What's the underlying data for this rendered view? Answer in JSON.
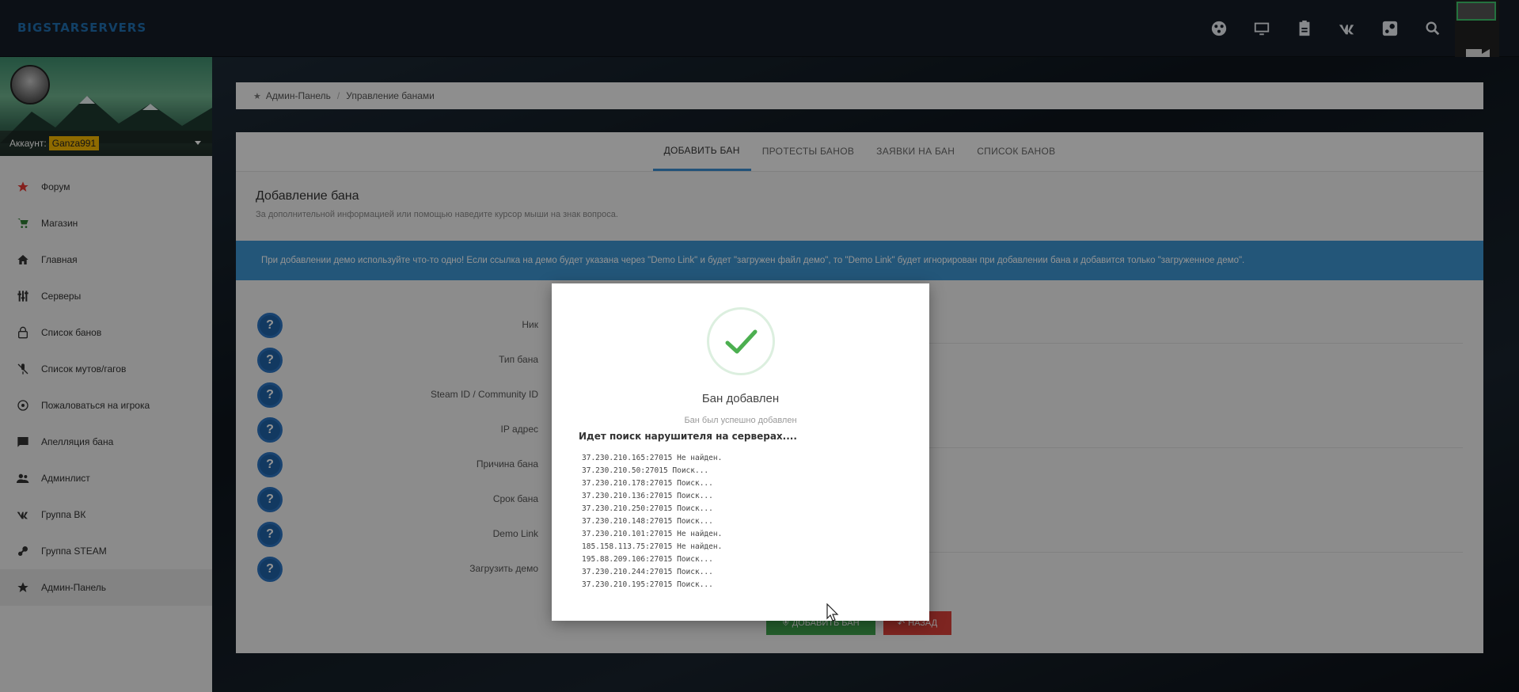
{
  "topbar": {
    "logo": "BIGSTARSERVERS",
    "icons": [
      "globe-icon",
      "monitor-icon",
      "clipboard-icon",
      "vk-icon",
      "steam-icon",
      "search-icon"
    ]
  },
  "sidebar": {
    "account_label": "Аккаунт:",
    "account_name": "Ganza991",
    "items": [
      {
        "label": "Форум",
        "icon": "star-icon",
        "icon_color": "#e53935"
      },
      {
        "label": "Магазин",
        "icon": "cart-icon",
        "icon_color": "#2e7d32"
      },
      {
        "label": "Главная",
        "icon": "home-icon"
      },
      {
        "label": "Серверы",
        "icon": "sliders-icon"
      },
      {
        "label": "Список банов",
        "icon": "lock-icon"
      },
      {
        "label": "Список мутов/гагов",
        "icon": "mic-off-icon"
      },
      {
        "label": "Пожаловаться на игрока",
        "icon": "target-icon"
      },
      {
        "label": "Апелляция бана",
        "icon": "message-icon"
      },
      {
        "label": "Админлист",
        "icon": "users-icon"
      },
      {
        "label": "Группа ВК",
        "icon": "vk-icon"
      },
      {
        "label": "Группа STEAM",
        "icon": "steam-icon"
      },
      {
        "label": "Админ-Панель",
        "icon": "star-icon",
        "active": true
      }
    ]
  },
  "breadcrumb": {
    "home": "Админ-Панель",
    "sep": "/",
    "current": "Управление банами"
  },
  "tabs": [
    {
      "label": "ДОБАВИТЬ БАН",
      "active": true
    },
    {
      "label": "ПРОТЕСТЫ БАНОВ"
    },
    {
      "label": "ЗАЯВКИ НА БАН"
    },
    {
      "label": "СПИСОК БАНОВ"
    }
  ],
  "panel": {
    "title": "Добавление бана",
    "subtitle": "За дополнительной информацией или помощью наведите курсор мыши на знак вопроса.",
    "info": "При добавлении демо используйте что-то одно! Если ссылка на демо будет указана через \"Demo Link\" и будет \"загружен файл демо\", то \"Demo Link\" будет игнорирован при добавлении бана и добавится только \"загруженное демо\"."
  },
  "form": {
    "help_glyph": "?",
    "fields": [
      "Ник",
      "Тип бана",
      "Steam ID / Community ID",
      "IP адрес",
      "Причина бана",
      "Срок бана",
      "Demo Link",
      "Загрузить демо"
    ]
  },
  "buttons": {
    "add": "ДОБАВИТЬ БАН",
    "back": "НАЗАД"
  },
  "modal": {
    "title": "Бан добавлен",
    "text": "Бан был успешно добавлен",
    "search_title": "Идет поиск нарушителя на серверах....",
    "log": [
      "37.230.210.165:27015 Не найден.",
      "37.230.210.50:27015  Поиск...",
      "37.230.210.178:27015 Поиск...",
      "37.230.210.136:27015 Поиск...",
      "37.230.210.250:27015 Поиск...",
      "37.230.210.148:27015 Поиск...",
      "37.230.210.101:27015 Не найден.",
      "185.158.113.75:27015 Не найден.",
      "195.88.209.106:27015 Поиск...",
      "37.230.210.244:27015 Поиск...",
      "37.230.210.195:27015 Поиск..."
    ]
  },
  "colors": {
    "accent": "#3d95d1",
    "success": "#4caf50",
    "danger": "#d9403a",
    "badge": "#f5b700"
  }
}
